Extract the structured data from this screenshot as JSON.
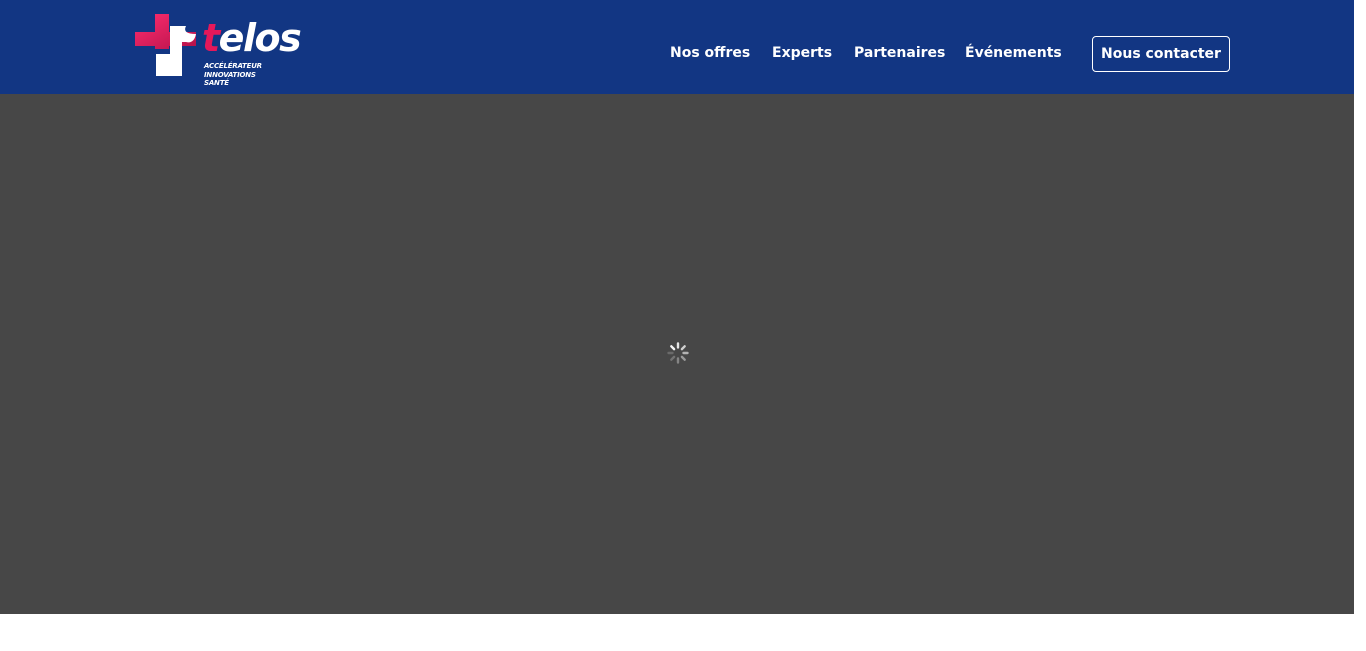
{
  "brand": {
    "name": "telos",
    "name_lead": "t",
    "name_rest": "elos",
    "tagline_lines": [
      "ACCÉLÉRATEUR",
      "INNOVATIONS",
      "SANTÉ"
    ],
    "colors": {
      "navy": "#123683",
      "pink": "#e5185a",
      "white": "#ffffff"
    }
  },
  "nav": {
    "items": [
      {
        "label": "Nos offres"
      },
      {
        "label": "Experts"
      },
      {
        "label": "Partenaires"
      },
      {
        "label": "Événements"
      }
    ],
    "cta_label": "Nous contacter"
  },
  "hero": {
    "state": "loading",
    "background": "#474747",
    "loader_icon": "spinner-icon"
  }
}
